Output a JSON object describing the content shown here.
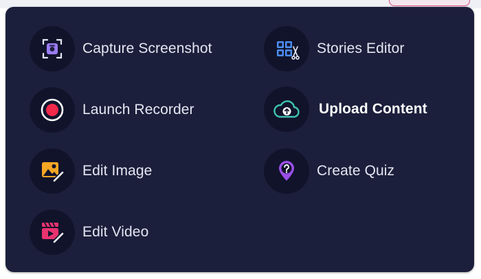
{
  "menu": {
    "items": [
      {
        "id": "capture-screenshot",
        "label": "Capture Screenshot",
        "icon": "screenshot-capture-icon",
        "color": "#9b7cf5"
      },
      {
        "id": "stories-editor",
        "label": "Stories Editor",
        "icon": "stories-editor-icon",
        "color": "#4a8df0"
      },
      {
        "id": "launch-recorder",
        "label": "Launch Recorder",
        "icon": "record-icon",
        "color": "#f0284a"
      },
      {
        "id": "upload-content",
        "label": "Upload Content",
        "icon": "cloud-upload-icon",
        "color": "#3fc4b0"
      },
      {
        "id": "edit-image",
        "label": "Edit Image",
        "icon": "image-edit-icon",
        "color": "#f5a623"
      },
      {
        "id": "create-quiz",
        "label": "Create Quiz",
        "icon": "quiz-icon",
        "color": "#9a4fe8"
      },
      {
        "id": "edit-video",
        "label": "Edit Video",
        "icon": "video-edit-icon",
        "color": "#e8336f"
      }
    ]
  },
  "colors": {
    "panel_background": "#1c1f3b",
    "icon_background": "#11132b",
    "label_text": "#e4e6f2"
  }
}
